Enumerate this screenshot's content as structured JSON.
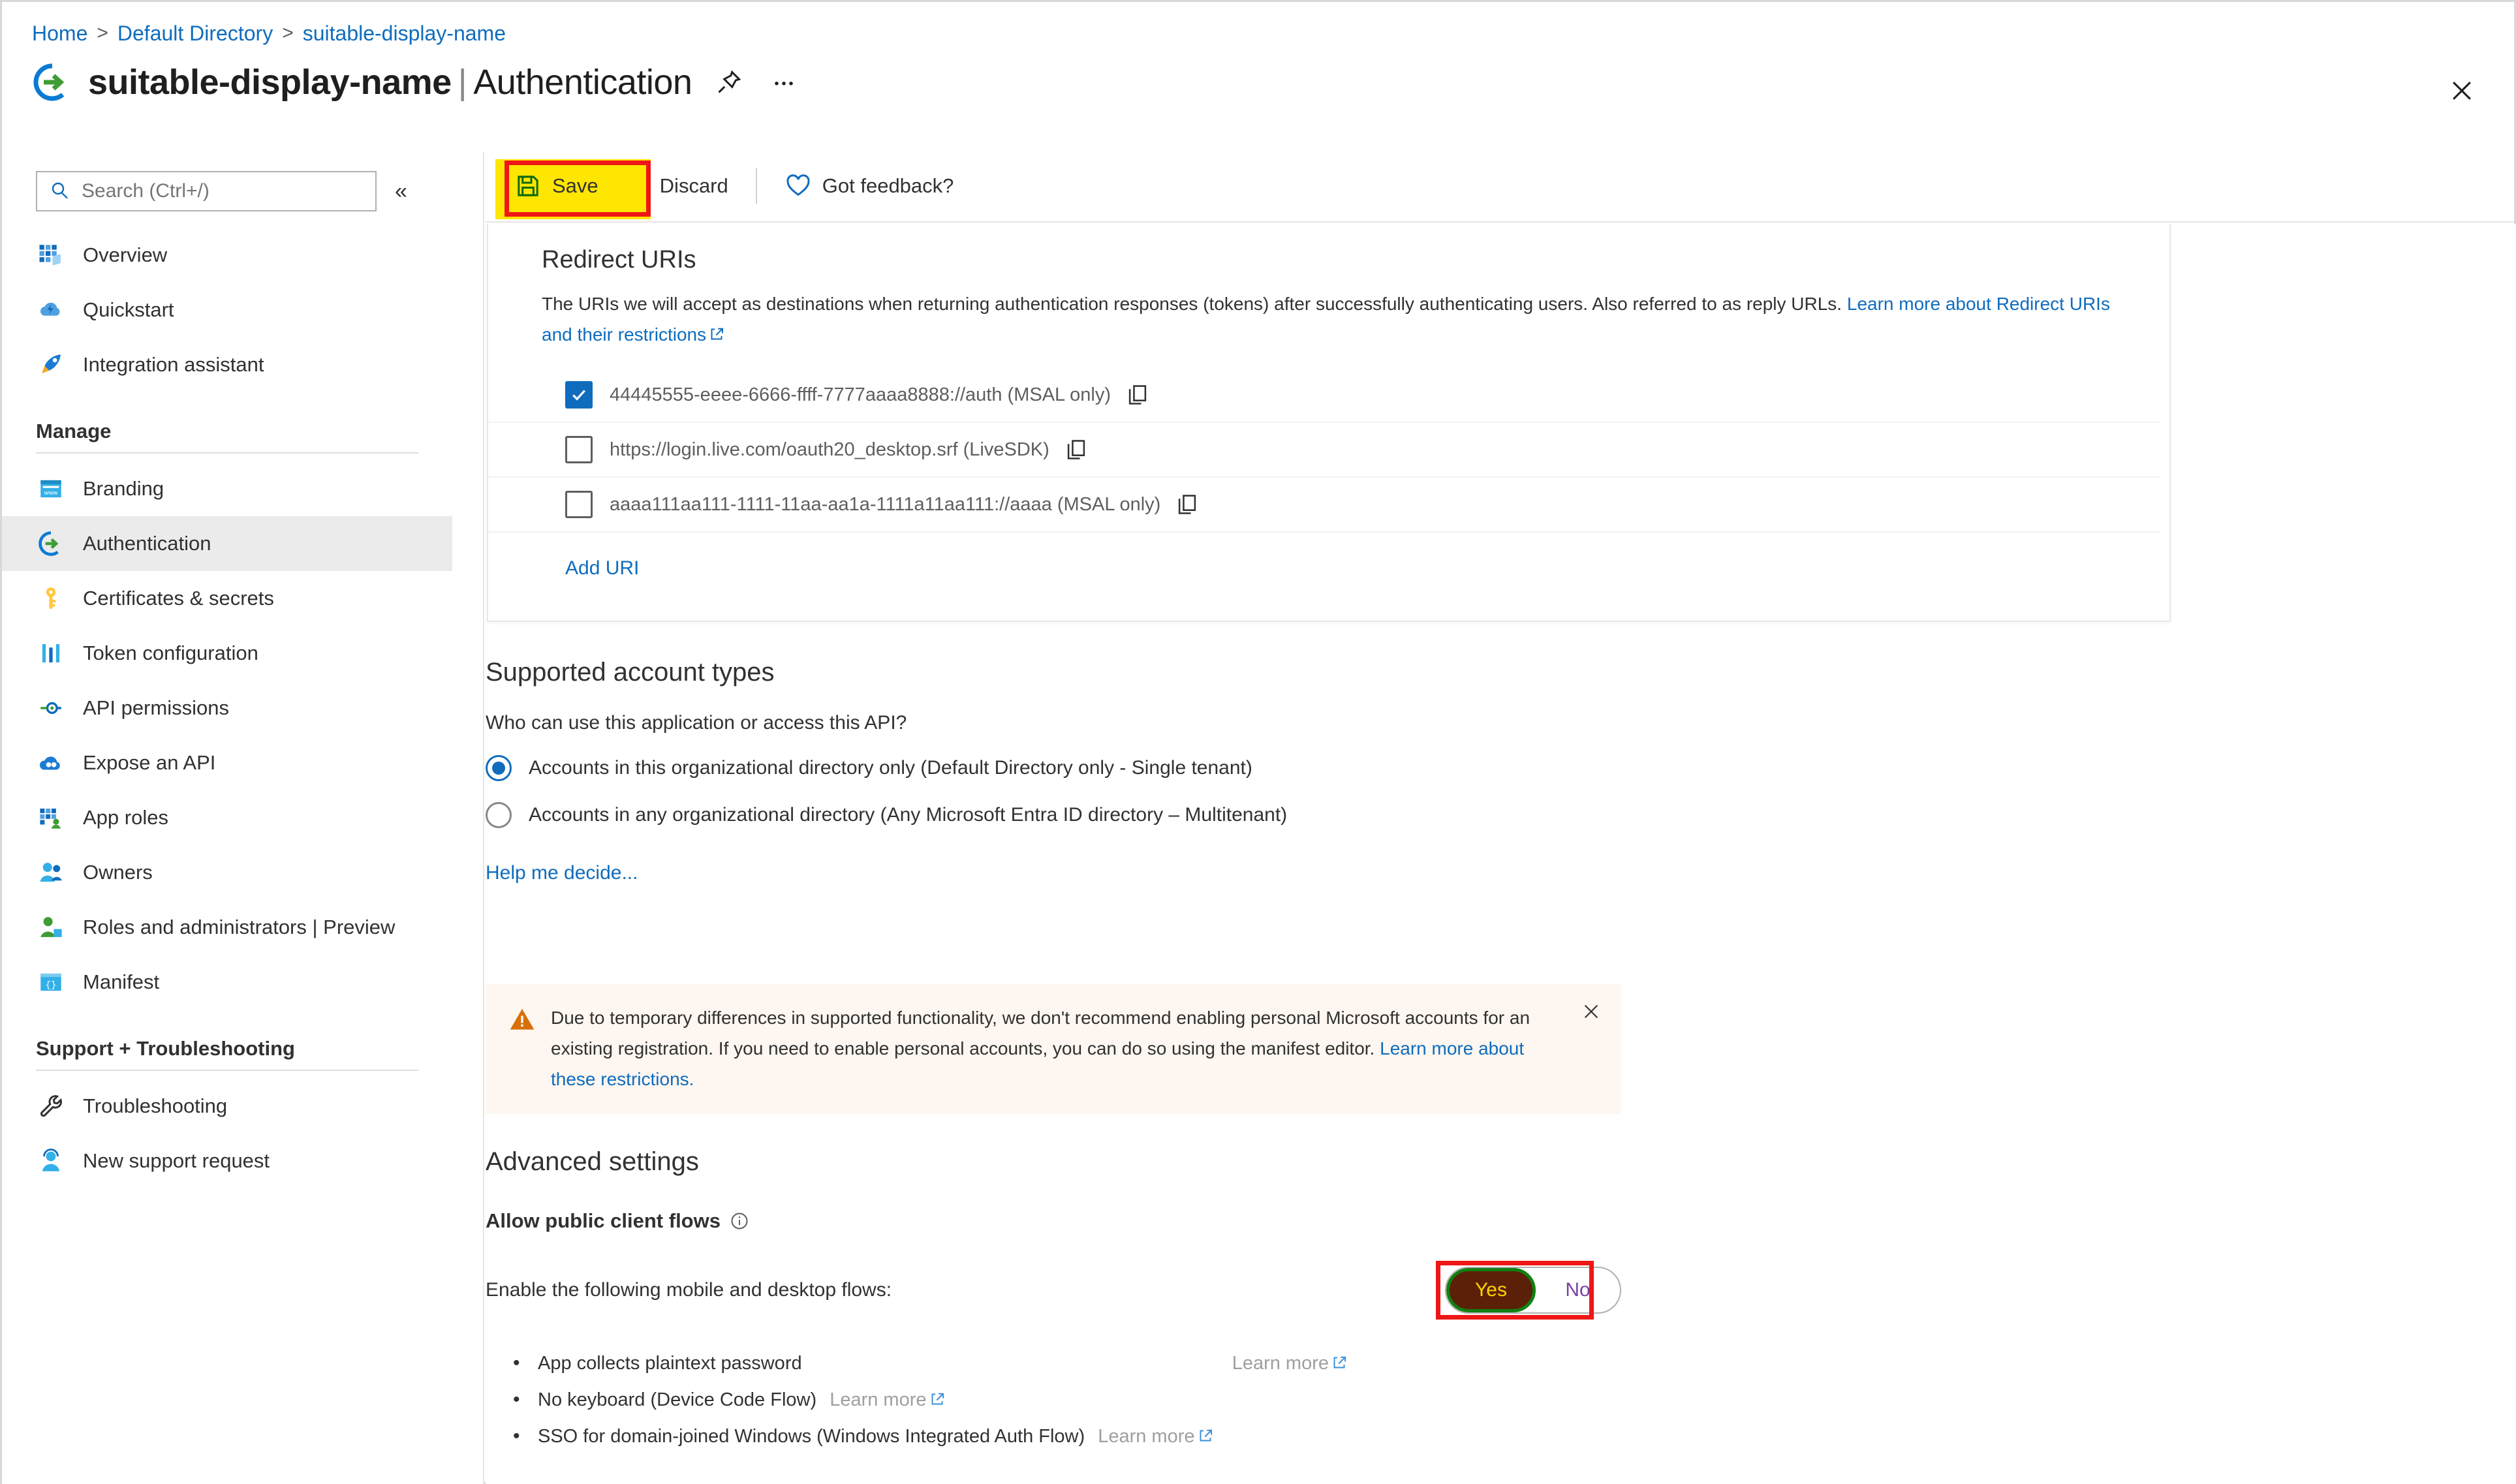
{
  "breadcrumb": {
    "items": [
      "Home",
      "Default Directory",
      "suitable-display-name"
    ],
    "separator": ">"
  },
  "header": {
    "app_name": "suitable-display-name",
    "section": "Authentication",
    "divider": "|",
    "pin_icon": "pin-icon",
    "more_icon": "ellipsis-icon",
    "close_icon": "close-icon"
  },
  "sidebar": {
    "search": {
      "placeholder": "Search (Ctrl+/)",
      "value": "",
      "icon": "search-icon"
    },
    "collapse_icon": "«",
    "items": [
      {
        "label": "Overview",
        "icon": "overview-icon",
        "selected": false
      },
      {
        "label": "Quickstart",
        "icon": "quickstart-icon",
        "selected": false
      },
      {
        "label": "Integration assistant",
        "icon": "rocket-icon",
        "selected": false
      }
    ],
    "groups": [
      {
        "title": "Manage",
        "items": [
          {
            "label": "Branding",
            "icon": "branding-icon",
            "selected": false
          },
          {
            "label": "Authentication",
            "icon": "authentication-icon",
            "selected": true
          },
          {
            "label": "Certificates & secrets",
            "icon": "key-icon",
            "selected": false
          },
          {
            "label": "Token configuration",
            "icon": "token-icon",
            "selected": false
          },
          {
            "label": "API permissions",
            "icon": "api-permissions-icon",
            "selected": false
          },
          {
            "label": "Expose an API",
            "icon": "expose-api-icon",
            "selected": false
          },
          {
            "label": "App roles",
            "icon": "app-roles-icon",
            "selected": false
          },
          {
            "label": "Owners",
            "icon": "owners-icon",
            "selected": false
          },
          {
            "label": "Roles and administrators | Preview",
            "icon": "roles-admins-icon",
            "selected": false
          },
          {
            "label": "Manifest",
            "icon": "manifest-icon",
            "selected": false
          }
        ]
      },
      {
        "title": "Support + Troubleshooting",
        "items": [
          {
            "label": "Troubleshooting",
            "icon": "wrench-icon",
            "selected": false
          },
          {
            "label": "New support request",
            "icon": "support-icon",
            "selected": false
          }
        ]
      }
    ]
  },
  "toolbar": {
    "save_label": "Save",
    "save_icon": "save-icon",
    "discard_label": "Discard",
    "discard_icon": "discard-x-icon",
    "feedback_label": "Got feedback?",
    "feedback_icon": "heart-icon"
  },
  "redirect_uris": {
    "title": "Redirect URIs",
    "description": "The URIs we will accept as destinations when returning authentication responses (tokens) after successfully authenticating users. Also referred to as reply URLs.",
    "learn_more": "Learn more about Redirect URIs and their restrictions",
    "rows": [
      {
        "uri": "44445555-eeee-6666-ffff-7777aaaa8888://auth (MSAL only)",
        "checked": true,
        "copy_icon": "copy-icon"
      },
      {
        "uri": "https://login.live.com/oauth20_desktop.srf (LiveSDK)",
        "checked": false,
        "copy_icon": "copy-icon"
      },
      {
        "uri": "aaaa111aa111-1111-11aa-aa1a-1111a11aa111://aaaa (MSAL only)",
        "checked": false,
        "copy_icon": "copy-icon"
      }
    ],
    "add_uri_label": "Add URI"
  },
  "supported_account_types": {
    "title": "Supported account types",
    "question": "Who can use this application or access this API?",
    "options": [
      {
        "label": "Accounts in this organizational directory only (Default Directory only - Single tenant)",
        "selected": true
      },
      {
        "label": "Accounts in any organizational directory (Any Microsoft Entra ID directory – Multitenant)",
        "selected": false
      }
    ],
    "help_link": "Help me decide..."
  },
  "warning": {
    "icon": "warning-triangle-icon",
    "text": "Due to temporary differences in supported functionality, we don't recommend enabling personal Microsoft accounts for an existing registration. If you need to enable personal accounts, you can do so using the manifest editor.",
    "link": "Learn more about these restrictions.",
    "close_icon": "close-icon"
  },
  "advanced_settings": {
    "title": "Advanced settings",
    "subtitle": "Allow public client flows",
    "info_icon": "info-icon",
    "flow_label": "Enable the following mobile and desktop flows:",
    "toggle": {
      "yes_label": "Yes",
      "no_label": "No",
      "value": "Yes"
    },
    "bullets": [
      {
        "text": "App collects plaintext password",
        "learn_more": "Learn more",
        "link_trailing": true
      },
      {
        "text": "No keyboard (Device Code Flow)",
        "learn_more": "Learn more",
        "link_trailing": false
      },
      {
        "text": "SSO for domain-joined Windows (Windows Integrated Auth Flow)",
        "learn_more": "Learn more",
        "link_trailing": false
      }
    ]
  },
  "annotations": {
    "highlight_color": "#ffe600",
    "box_color": "#ef1616",
    "targets": [
      "save-button",
      "public-client-flows-yes-toggle"
    ]
  },
  "colors": {
    "link": "#0f6cbd",
    "accent": "#0f6cbd",
    "selected_nav_bg": "#ebebeb",
    "warning_bg": "#fdf6f1",
    "warning_icon": "#d8700a"
  }
}
